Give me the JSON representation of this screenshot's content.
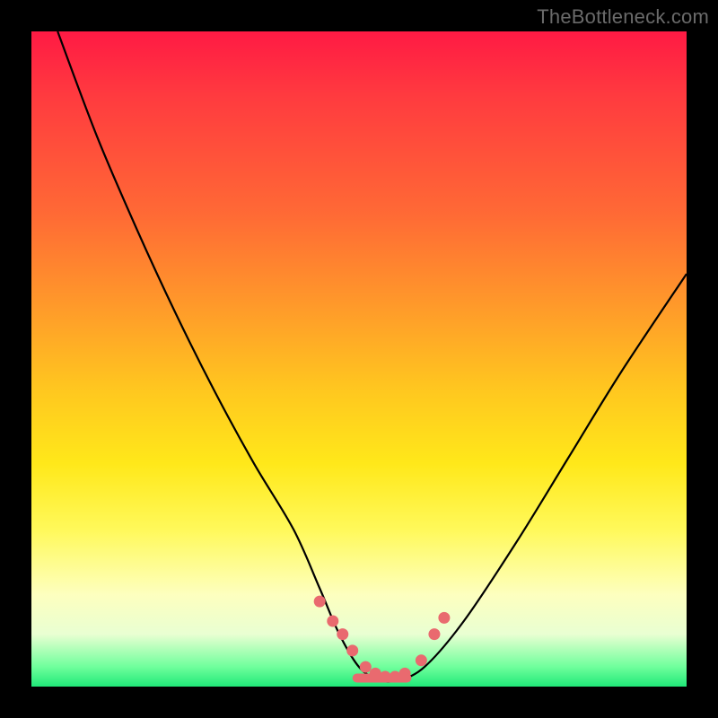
{
  "watermark": "TheBottleneck.com",
  "chart_data": {
    "type": "line",
    "title": "",
    "xlabel": "",
    "ylabel": "",
    "xlim": [
      0,
      100
    ],
    "ylim": [
      0,
      100
    ],
    "series": [
      {
        "name": "bottleneck-curve",
        "x": [
          4,
          10,
          16,
          22,
          28,
          34,
          40,
          44,
          47,
          50,
          53,
          56,
          60,
          66,
          74,
          82,
          90,
          100
        ],
        "values": [
          100,
          84,
          70,
          57,
          45,
          34,
          24,
          15,
          8,
          3,
          1,
          1,
          3,
          10,
          22,
          35,
          48,
          63
        ]
      }
    ],
    "markers": {
      "name": "highlight-dots",
      "color": "#e96a6f",
      "x": [
        44.0,
        46.0,
        47.5,
        49.0,
        51.0,
        52.5,
        54.0,
        55.5,
        57.0,
        59.5,
        61.5,
        63.0
      ],
      "values": [
        13.0,
        10.0,
        8.0,
        5.5,
        3.0,
        2.0,
        1.5,
        1.5,
        2.0,
        4.0,
        8.0,
        10.5
      ]
    },
    "floor_bar": {
      "color": "#e96a6f",
      "x_start": 49.0,
      "x_end": 58.0,
      "y": 1.3
    }
  }
}
